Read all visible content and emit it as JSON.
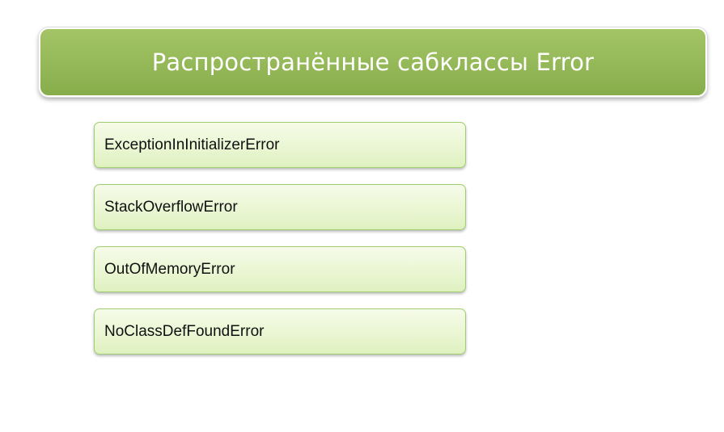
{
  "title": "Распространённые сабклассы Error",
  "errors": [
    {
      "label": "ExceptionInInitializerError"
    },
    {
      "label": "StackOverflowError"
    },
    {
      "label": "OutOfMemoryError"
    },
    {
      "label": "NoClassDefFoundError"
    }
  ],
  "colors": {
    "banner": "#94b858",
    "item_fill": "#eaf6d3",
    "item_border": "#9fcf6e"
  }
}
